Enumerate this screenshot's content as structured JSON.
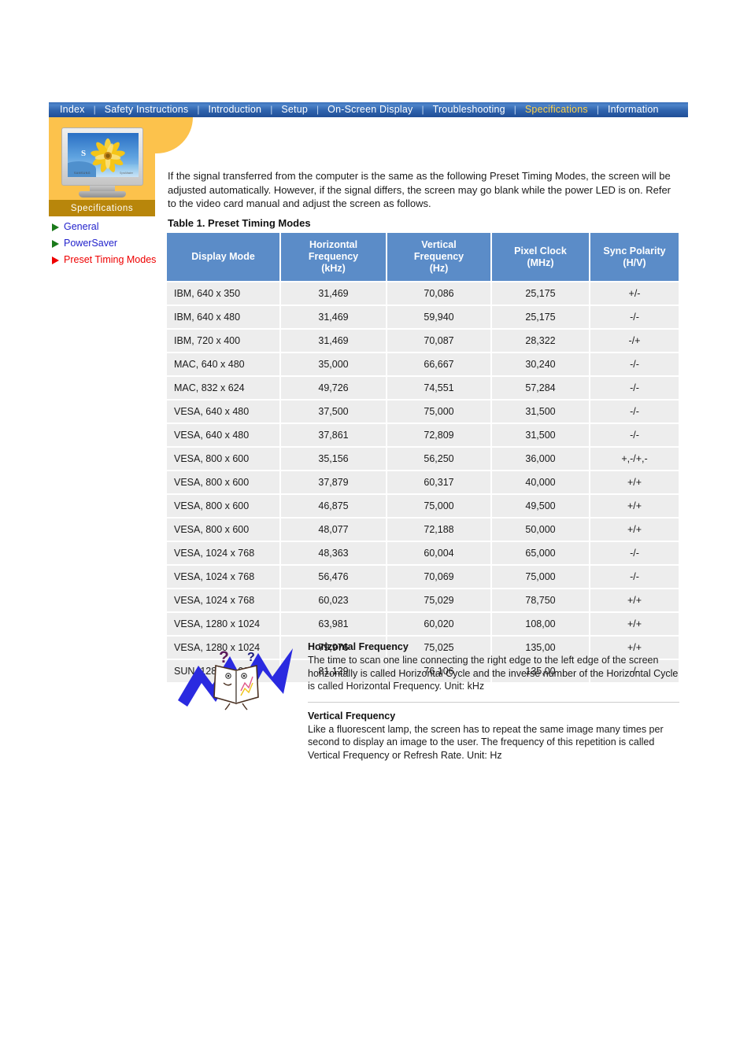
{
  "nav": {
    "separator": "|",
    "items": [
      {
        "label": "Index",
        "active": false
      },
      {
        "label": "Safety Instructions",
        "active": false
      },
      {
        "label": "Introduction",
        "active": false
      },
      {
        "label": "Setup",
        "active": false
      },
      {
        "label": "On-Screen Display",
        "active": false
      },
      {
        "label": "Troubleshooting",
        "active": false
      },
      {
        "label": "Specifications",
        "active": true
      },
      {
        "label": "Information",
        "active": false
      }
    ],
    "active_color": "#ffd24a",
    "bar_color": "#2f63ad"
  },
  "logo": {
    "caption": "Specifications",
    "monitor_brand": "SAMSUNG",
    "monitor_model": "SyncMaster",
    "screen_letter": "S",
    "panel_color": "#fcc24c",
    "caption_bar_color": "#b8860b"
  },
  "sidebar": {
    "items": [
      {
        "label": "General",
        "current": false,
        "bullet_color": "#1a7a1a"
      },
      {
        "label": "PowerSaver",
        "current": false,
        "bullet_color": "#1a7a1a"
      },
      {
        "label": "Preset Timing Modes",
        "current": true,
        "bullet_color": "#ee0000"
      }
    ]
  },
  "main": {
    "intro": "If the signal transferred from the computer is the same as the following Preset Timing Modes, the screen will be adjusted automatically. However, if the signal differs, the screen may go blank while the power LED is on. Refer to the video card manual and adjust the screen as follows.",
    "table_caption": "Table 1. Preset Timing Modes"
  },
  "chart_data": {
    "type": "table",
    "title": "Table 1. Preset Timing Modes",
    "columns": [
      "Display Mode",
      "Horizontal\nFrequency\n(kHz)",
      "Vertical\nFrequency\n(Hz)",
      "Pixel Clock\n(MHz)",
      "Sync Polarity\n(H/V)"
    ],
    "header": {
      "display_mode": "Display Mode",
      "horizontal_frequency": [
        "Horizontal",
        "Frequency",
        "(kHz)"
      ],
      "vertical_frequency": [
        "Vertical",
        "Frequency",
        "(Hz)"
      ],
      "pixel_clock": [
        "Pixel Clock",
        "(MHz)"
      ],
      "sync_polarity": [
        "Sync Polarity",
        "(H/V)"
      ]
    },
    "rows": [
      [
        "IBM, 640 x 350",
        "31,469",
        "70,086",
        "25,175",
        "+/-"
      ],
      [
        "IBM, 640 x 480",
        "31,469",
        "59,940",
        "25,175",
        "-/-"
      ],
      [
        "IBM, 720 x 400",
        "31,469",
        "70,087",
        "28,322",
        "-/+"
      ],
      [
        "MAC, 640 x 480",
        "35,000",
        "66,667",
        "30,240",
        "-/-"
      ],
      [
        "MAC, 832 x 624",
        "49,726",
        "74,551",
        "57,284",
        "-/-"
      ],
      [
        "VESA, 640 x 480",
        "37,500",
        "75,000",
        "31,500",
        "-/-"
      ],
      [
        "VESA, 640 x 480",
        "37,861",
        "72,809",
        "31,500",
        "-/-"
      ],
      [
        "VESA, 800 x 600",
        "35,156",
        "56,250",
        "36,000",
        "+,-/+,-"
      ],
      [
        "VESA, 800 x 600",
        "37,879",
        "60,317",
        "40,000",
        "+/+"
      ],
      [
        "VESA, 800 x 600",
        "46,875",
        "75,000",
        "49,500",
        "+/+"
      ],
      [
        "VESA, 800 x 600",
        "48,077",
        "72,188",
        "50,000",
        "+/+"
      ],
      [
        "VESA, 1024 x 768",
        "48,363",
        "60,004",
        "65,000",
        "-/-"
      ],
      [
        "VESA, 1024 x 768",
        "56,476",
        "70,069",
        "75,000",
        "-/-"
      ],
      [
        "VESA, 1024 x 768",
        "60,023",
        "75,029",
        "78,750",
        "+/+"
      ],
      [
        "VESA, 1280 x 1024",
        "63,981",
        "60,020",
        "108,00",
        "+/+"
      ],
      [
        "VESA, 1280 x 1024",
        "79,976",
        "75,025",
        "135,00",
        "+/+"
      ],
      [
        "SUN, 1280 x 1024",
        "81,129",
        "76,106",
        "135,00",
        "-/-"
      ]
    ],
    "header_bg": "#5b8cc8",
    "cell_bg": "#ededed",
    "grid": "white separators"
  },
  "notes": [
    {
      "title": "Horizontal Frequency",
      "body": "The time to scan one line connecting the right edge to the left edge of the screen horizontally is called Horizontal Cycle and the inverse number of the Horizontal Cycle is called Horizontal Frequency. Unit: kHz"
    },
    {
      "title": "Vertical Frequency",
      "body": "Like a fluorescent lamp, the screen has to repeat the same image many times per second to display an image to the user. The frequency of this repetition is called Vertical Frequency or Refresh Rate. Unit: Hz"
    }
  ]
}
